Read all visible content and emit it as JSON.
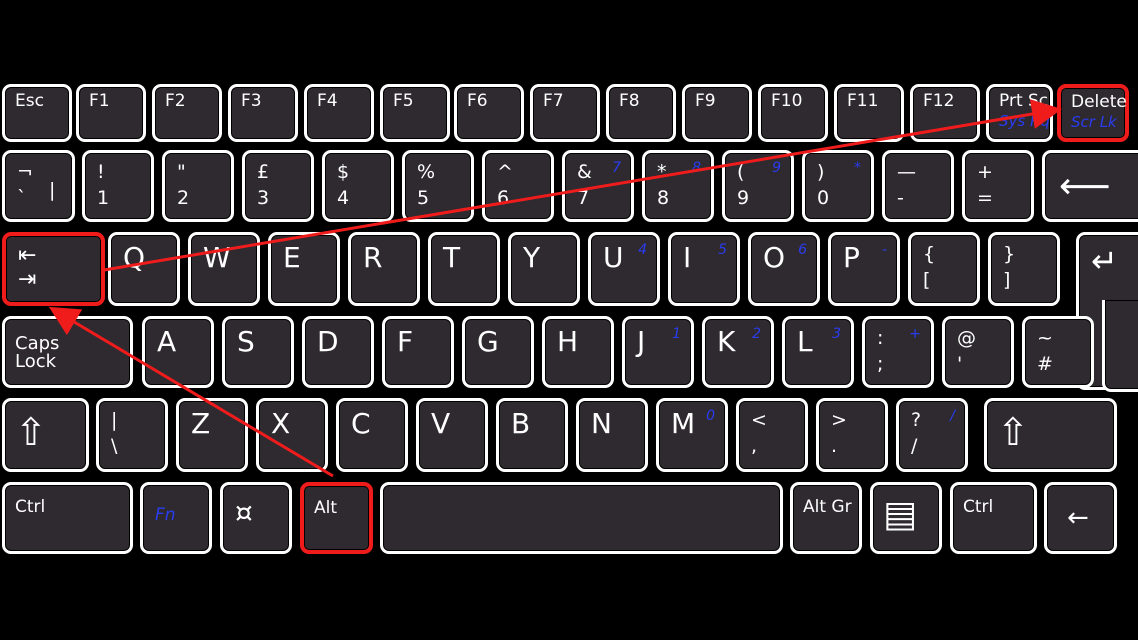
{
  "highlight_color": "#f01c1c",
  "fn_label_color": "#2a3cf0",
  "keys": [
    {
      "name": "esc",
      "label": "Esc"
    },
    {
      "name": "f1",
      "label": "F1"
    },
    {
      "name": "f2",
      "label": "F2"
    },
    {
      "name": "f3",
      "label": "F3"
    },
    {
      "name": "f4",
      "label": "F4"
    },
    {
      "name": "f5",
      "label": "F5"
    },
    {
      "name": "f6",
      "label": "F6"
    },
    {
      "name": "f7",
      "label": "F7"
    },
    {
      "name": "f8",
      "label": "F8"
    },
    {
      "name": "f9",
      "label": "F9"
    },
    {
      "name": "f10",
      "label": "F10"
    },
    {
      "name": "f11",
      "label": "F11"
    },
    {
      "name": "f12",
      "label": "F12"
    },
    {
      "name": "prtsc",
      "label": "Prt Sc",
      "sub": "Sys Rq"
    },
    {
      "name": "delete",
      "label": "Delete",
      "sub": "Scr Lk",
      "highlighted": true
    },
    {
      "name": "backtick",
      "top": "¬",
      "bot": "`",
      "side": "|"
    },
    {
      "name": "1",
      "top": "!",
      "bot": "1"
    },
    {
      "name": "2",
      "top": "\"",
      "bot": "2"
    },
    {
      "name": "3",
      "top": "£",
      "bot": "3"
    },
    {
      "name": "4",
      "top": "$",
      "bot": "4"
    },
    {
      "name": "5",
      "top": "%",
      "bot": "5"
    },
    {
      "name": "6",
      "top": "^",
      "bot": "6"
    },
    {
      "name": "7",
      "top": "&",
      "bot": "7",
      "fn": "7"
    },
    {
      "name": "8",
      "top": "*",
      "bot": "8",
      "fn": "8"
    },
    {
      "name": "9",
      "top": "(",
      "bot": "9",
      "fn": "9"
    },
    {
      "name": "0",
      "top": ")",
      "bot": "0",
      "fn": "*"
    },
    {
      "name": "minus",
      "top": "—",
      "bot": "-"
    },
    {
      "name": "equals",
      "top": "+",
      "bot": "="
    },
    {
      "name": "backspace",
      "icon": "⟵",
      "icon_name": "backspace-arrow-icon"
    },
    {
      "name": "tab",
      "icon": "⇤\n⇥",
      "icon_name": "tab-arrows-icon",
      "highlighted": true
    },
    {
      "name": "q",
      "big": "Q"
    },
    {
      "name": "w",
      "big": "W"
    },
    {
      "name": "e",
      "big": "E"
    },
    {
      "name": "r",
      "big": "R"
    },
    {
      "name": "t",
      "big": "T"
    },
    {
      "name": "y",
      "big": "Y"
    },
    {
      "name": "u",
      "big": "U",
      "fn": "4"
    },
    {
      "name": "i",
      "big": "I",
      "fn": "5"
    },
    {
      "name": "o",
      "big": "O",
      "fn": "6"
    },
    {
      "name": "p",
      "big": "P",
      "fn": "-"
    },
    {
      "name": "lbracket",
      "top": "{",
      "bot": "["
    },
    {
      "name": "rbracket",
      "top": "}",
      "bot": "]"
    },
    {
      "name": "enter",
      "icon": "↵",
      "icon_name": "enter-arrow-icon"
    },
    {
      "name": "capslock",
      "label": "Caps\nLock"
    },
    {
      "name": "a",
      "big": "A"
    },
    {
      "name": "s",
      "big": "S"
    },
    {
      "name": "d",
      "big": "D"
    },
    {
      "name": "f",
      "big": "F"
    },
    {
      "name": "g",
      "big": "G"
    },
    {
      "name": "h",
      "big": "H"
    },
    {
      "name": "j",
      "big": "J",
      "fn": "1"
    },
    {
      "name": "k",
      "big": "K",
      "fn": "2"
    },
    {
      "name": "l",
      "big": "L",
      "fn": "3"
    },
    {
      "name": "semicolon",
      "top": ":",
      "bot": ";",
      "fn": "+"
    },
    {
      "name": "quote",
      "top": "@",
      "bot": "'"
    },
    {
      "name": "hash",
      "top": "~",
      "bot": "#"
    },
    {
      "name": "lshift",
      "icon": "⇧",
      "icon_name": "shift-arrow-icon"
    },
    {
      "name": "backslash",
      "top": "|",
      "bot": "\\"
    },
    {
      "name": "z",
      "big": "Z"
    },
    {
      "name": "x",
      "big": "X"
    },
    {
      "name": "c",
      "big": "C"
    },
    {
      "name": "v",
      "big": "V"
    },
    {
      "name": "b",
      "big": "B"
    },
    {
      "name": "n",
      "big": "N"
    },
    {
      "name": "m",
      "big": "M",
      "fn": "0"
    },
    {
      "name": "comma",
      "top": "<",
      "bot": ","
    },
    {
      "name": "period",
      "top": ">",
      "bot": "."
    },
    {
      "name": "slash",
      "top": "?",
      "bot": "/",
      "fn": "/"
    },
    {
      "name": "rshift",
      "icon": "⇧",
      "icon_name": "shift-arrow-icon"
    },
    {
      "name": "lctrl",
      "label": "Ctrl"
    },
    {
      "name": "fn",
      "label": "Fn",
      "blue": true
    },
    {
      "name": "win",
      "icon": "¤",
      "icon_name": "super-key-icon"
    },
    {
      "name": "alt",
      "label": "Alt",
      "highlighted": true
    },
    {
      "name": "space"
    },
    {
      "name": "altgr",
      "label": "Alt Gr"
    },
    {
      "name": "menu",
      "icon": "▤",
      "icon_name": "context-menu-icon"
    },
    {
      "name": "rctrl",
      "label": "Ctrl"
    },
    {
      "name": "left",
      "icon": "←",
      "icon_name": "left-arrow-icon"
    }
  ]
}
